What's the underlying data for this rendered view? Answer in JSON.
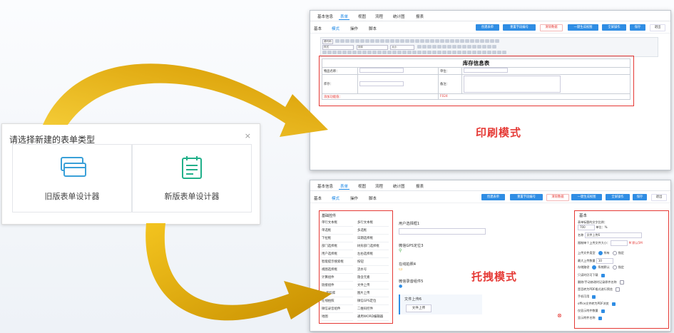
{
  "dialog": {
    "title": "请选择新建的表单类型",
    "close": "×",
    "options": [
      {
        "label": "旧版表单设计器",
        "icon": "card-stack-icon"
      },
      {
        "label": "新版表单设计器",
        "icon": "form-clipboard-icon"
      }
    ]
  },
  "arrows": {
    "color": "#e8b100"
  },
  "print_screen": {
    "tabs": [
      "基本信息",
      "表单",
      "视图",
      "流程",
      "统计图",
      "报表"
    ],
    "active_tab": "表单",
    "subtabs": [
      "基本",
      "模式",
      "操作",
      "脚本"
    ],
    "buttons": [
      "创建表单",
      "重置字段编号",
      "清除数据",
      "一键生成视图",
      "全屏操作",
      "保存",
      "退出"
    ],
    "toolbar": {
      "source": "源代码",
      "style": "样式",
      "font": "字体",
      "size": "大小"
    },
    "form_title": "库存信息表",
    "rows": [
      {
        "label": "物品名称：",
        "label2": "单位："
      },
      {
        "label": "库存：",
        "label2": "备注："
      },
      {
        "label": "添加功能值：",
        "label2": "F024"
      }
    ]
  },
  "drag_screen": {
    "tabs": [
      "基本信息",
      "表单",
      "视图",
      "流程",
      "统计图",
      "报表"
    ],
    "subtabs": [
      "基本",
      "模式",
      "操作",
      "脚本"
    ],
    "buttons": [
      "创建表单",
      "重置字段编号",
      "清除数据",
      "一键生成视图",
      "全屏操作",
      "保存",
      "退出"
    ],
    "palette_title": "基础控件",
    "palette_items": [
      "单行文本框",
      "多行文本框",
      "单选框",
      "多选框",
      "下拉框",
      "日期选择框",
      "部门选择框",
      "树形部门选择框",
      "用户选择框",
      "左右选择框",
      "智能提示搜索框",
      "按钮",
      "视图选择框",
      "流水号",
      "计算组件",
      "隐含元素",
      "链接组件",
      "文件上传",
      "kis资料库",
      "图片上传",
      "在线拍照",
      "微信GPS定位",
      "微信录音组件",
      "二维码控件",
      "地图",
      "通用WORD编辑器"
    ],
    "fields": [
      "用户选择框1",
      "微信GPS定位3",
      "在线拍照4",
      "微信录音组件5"
    ],
    "upload": {
      "label": "文件上传6",
      "button": "文件上传"
    },
    "props_title": "基本",
    "props": [
      {
        "label": "表单标题的文字比例：",
        "value": "700",
        "unit": "单位：%"
      },
      {
        "label": "名称",
        "value": "文件上传6"
      },
      {
        "label": "限制单个上传文件大小：",
        "value": "",
        "unit": "M  默认5M"
      },
      {
        "label": "上传文件类型",
        "opt1": "所有",
        "opt2": "指定"
      },
      {
        "label": "最大上传数量",
        "value": "10"
      },
      {
        "label": "存储路径",
        "opt1": "系统默认",
        "opt2": "指定"
      },
      {
        "label": "只读时仍可下载"
      },
      {
        "label": "删除/手动修改时记录原件名称"
      },
      {
        "label": "是否转为PDF格式进行预览"
      },
      {
        "label": "手机可用"
      },
      {
        "label": "office文件转为PDF浏览"
      },
      {
        "label": "仅显示附件数量"
      },
      {
        "label": "显示附件名称"
      }
    ]
  },
  "mode_labels": {
    "print": "印刷模式",
    "drag": "托拽模式"
  }
}
